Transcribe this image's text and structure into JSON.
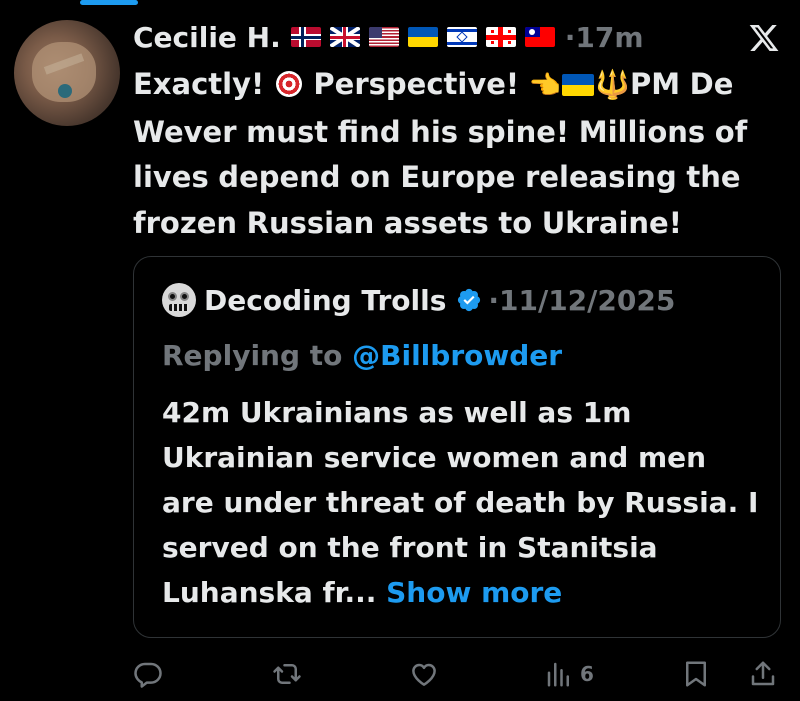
{
  "tweet": {
    "author_name": "Cecilie H.",
    "flags": [
      "norway-flag",
      "uk-flag",
      "usa-flag",
      "ukraine-flag",
      "israel-flag",
      "georgia-flag",
      "taiwan-flag"
    ],
    "time": "·17m",
    "text_part1": "Exactly! ",
    "text_part2": " Perspective! ",
    "text_part3": "PM De Wever must find his spine! Millions of lives depend on Europe releasing the frozen Russian assets to Ukraine!",
    "emojis": [
      "direct-hit-target-emoji",
      "backhand-pointing-left-emoji",
      "ukraine-flag-emoji",
      "trident-emoji"
    ]
  },
  "quote": {
    "author_name": "Decoding Trolls",
    "date": "·11/12/2025",
    "reply_prefix": "Replying to ",
    "reply_handle": "@Billbrowder",
    "text": "42m Ukrainians as well as 1m Ukrainian service women and men are under threat of death by Russia. I served on the front in Stanitsia Luhanska fr... ",
    "show_more": "Show more"
  },
  "actions": {
    "reply_icon": "reply-icon",
    "repost_icon": "repost-icon",
    "like_icon": "like-icon",
    "views_icon": "views-icon",
    "views_count": "6",
    "bookmark_icon": "bookmark-icon",
    "share_icon": "share-icon"
  },
  "colors": {
    "background": "#000000",
    "text": "#e7e9ea",
    "secondary": "#71767b",
    "accent": "#1d9bf0",
    "border": "#2f3336"
  }
}
